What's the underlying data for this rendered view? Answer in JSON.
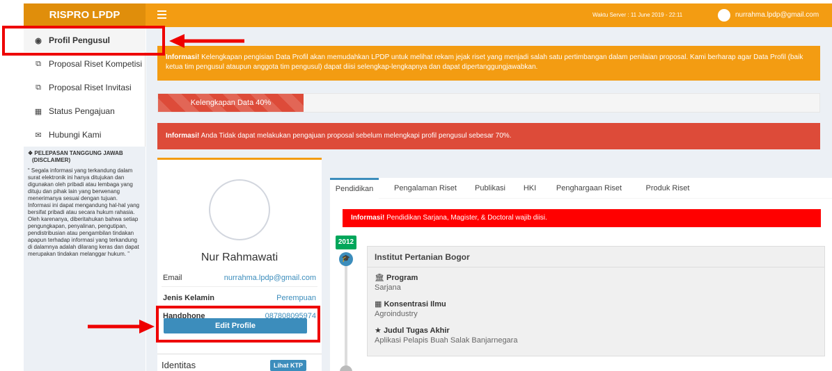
{
  "topbar": {
    "brand": "RISPRO LPDP",
    "server_time": "Waktu Server : 11 June 2019 - 22:11",
    "user_email": "nurrahma.lpdp@gmail.com"
  },
  "sidebar": {
    "items": [
      {
        "label": "Profil Pengusul",
        "icon": "dashboard-icon"
      },
      {
        "label": "Proposal Riset Kompetisi",
        "icon": "copy-icon"
      },
      {
        "label": "Proposal Riset Invitasi",
        "icon": "copy-icon"
      },
      {
        "label": "Status Pengajuan",
        "icon": "grid-icon"
      },
      {
        "label": "Hubungi Kami",
        "icon": "mail-icon"
      }
    ],
    "disclaimer_title": "PELEPASAN TANGGUNG JAWAB",
    "disclaimer_subtitle": "(DISCLAIMER)",
    "disclaimer_text": "Segala informasi yang terkandung dalam surat elektronik ini hanya ditujukan dan digunakan oleh pribadi atau lembaga yang dituju dan pihak lain yang berwenang menerimanya sesuai dengan tujuan. Informasi ini dapat mengandung hal-hal yang bersifat pribadi atau secara hukum rahasia. Oleh karenanya, diberitahukan bahwa setiap pengungkapan, penyalinan, pengutipan, pendistribusian atau pengambilan tindakan apapun terhadap informasi yang terkandung di dalamnya adalah dilarang keras dan dapat merupakan tindakan melanggar hukum. ”"
  },
  "alerts": {
    "warning_prefix": "Informasi!",
    "warning_text": " Kelengkapan pengisian Data Profil akan memudahkan LPDP untuk melihat rekam jejak riset yang menjadi salah satu pertimbangan dalam penilaian proposal. Kami berharap agar Data Profil (baik ketua tim pengusul ataupun anggota tim pengusul) dapat diisi selengkap-lengkapnya dan dapat dipertanggungjawabkan.",
    "danger_prefix": "Informasi!",
    "danger_text": " Anda Tidak dapat melakukan pengajuan proposal sebelum melengkapi profil pengusul sebesar 70%."
  },
  "progress": {
    "label": "Kelengkapan Data 40%",
    "percent": 40
  },
  "profile": {
    "name": "Nur Rahmawati",
    "rows": [
      {
        "key": "Email",
        "value": "nurrahma.lpdp@gmail.com"
      },
      {
        "key": "Jenis Kelamin",
        "value": "Perempuan"
      },
      {
        "key": "Handphone",
        "value": "087808095974"
      }
    ],
    "edit_button": "Edit Profile",
    "identitas_label": "Identitas",
    "ktp_button": "Lihat KTP"
  },
  "tabs": [
    "Pendidikan",
    "Pengalaman Riset",
    "Publikasi",
    "HKI",
    "Penghargaan Riset",
    "Produk Riset"
  ],
  "education": {
    "info_prefix": "Informasi!",
    "info_text": " Pendidikan Sarjana, Magister, & Doctoral wajib diisi.",
    "year": "2012",
    "institution": "Institut Pertanian Bogor",
    "program_label": "Program",
    "program_value": "Sarjana",
    "konsentrasi_label": "Konsentrasi Ilmu",
    "konsentrasi_value": "Agroindustry",
    "judul_label": "Judul Tugas Akhir",
    "judul_value": "Aplikasi Pelapis Buah Salak Banjarnegara"
  },
  "colors": {
    "header": "#f39c12",
    "danger": "#dd4b39",
    "primary": "#3c8dbc",
    "success": "#00a65a",
    "annotation": "#e00000"
  }
}
